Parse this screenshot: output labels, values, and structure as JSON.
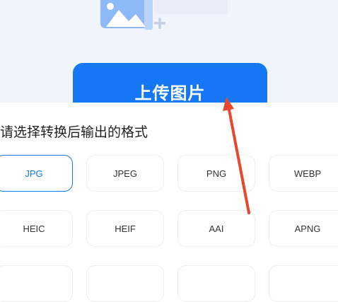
{
  "upload": {
    "label": "上传图片"
  },
  "section": {
    "title": "请选择转换后输出的格式"
  },
  "formats": [
    "JPG",
    "JPEG",
    "PNG",
    "WEBP",
    "HEIC",
    "HEIF",
    "AAI",
    "APNG",
    "",
    "",
    "",
    ""
  ],
  "selected_format": "JPG",
  "colors": {
    "accent": "#1677f4",
    "annotation_arrow": "#e5472f",
    "header_bg": "#f0f4fd"
  },
  "icons": [
    "image-add-icon",
    "annotation-arrow"
  ]
}
